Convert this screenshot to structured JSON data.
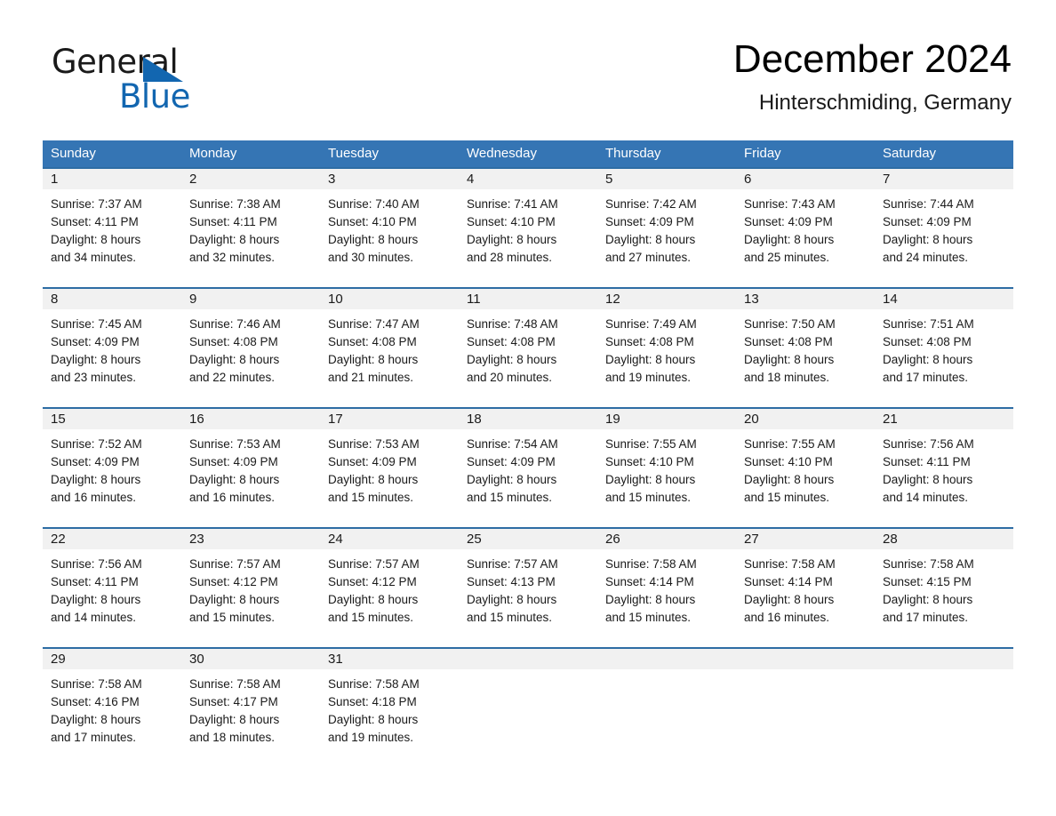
{
  "brand": {
    "name_part1": "General",
    "name_part2": "Blue",
    "triangle_color": "#1266b0",
    "logo_icon": "general-blue-logo"
  },
  "header": {
    "title": "December 2024",
    "location": "Hinterschmiding, Germany"
  },
  "colors": {
    "header_blue": "#3575b4",
    "row_divider_blue": "#2e6da4",
    "day_band_gray": "#f1f1f1",
    "text": "#1a1a1a"
  },
  "weekdays": [
    "Sunday",
    "Monday",
    "Tuesday",
    "Wednesday",
    "Thursday",
    "Friday",
    "Saturday"
  ],
  "weeks": [
    [
      {
        "day": "1",
        "sunrise": "Sunrise: 7:37 AM",
        "sunset": "Sunset: 4:11 PM",
        "daylight1": "Daylight: 8 hours",
        "daylight2": "and 34 minutes."
      },
      {
        "day": "2",
        "sunrise": "Sunrise: 7:38 AM",
        "sunset": "Sunset: 4:11 PM",
        "daylight1": "Daylight: 8 hours",
        "daylight2": "and 32 minutes."
      },
      {
        "day": "3",
        "sunrise": "Sunrise: 7:40 AM",
        "sunset": "Sunset: 4:10 PM",
        "daylight1": "Daylight: 8 hours",
        "daylight2": "and 30 minutes."
      },
      {
        "day": "4",
        "sunrise": "Sunrise: 7:41 AM",
        "sunset": "Sunset: 4:10 PM",
        "daylight1": "Daylight: 8 hours",
        "daylight2": "and 28 minutes."
      },
      {
        "day": "5",
        "sunrise": "Sunrise: 7:42 AM",
        "sunset": "Sunset: 4:09 PM",
        "daylight1": "Daylight: 8 hours",
        "daylight2": "and 27 minutes."
      },
      {
        "day": "6",
        "sunrise": "Sunrise: 7:43 AM",
        "sunset": "Sunset: 4:09 PM",
        "daylight1": "Daylight: 8 hours",
        "daylight2": "and 25 minutes."
      },
      {
        "day": "7",
        "sunrise": "Sunrise: 7:44 AM",
        "sunset": "Sunset: 4:09 PM",
        "daylight1": "Daylight: 8 hours",
        "daylight2": "and 24 minutes."
      }
    ],
    [
      {
        "day": "8",
        "sunrise": "Sunrise: 7:45 AM",
        "sunset": "Sunset: 4:09 PM",
        "daylight1": "Daylight: 8 hours",
        "daylight2": "and 23 minutes."
      },
      {
        "day": "9",
        "sunrise": "Sunrise: 7:46 AM",
        "sunset": "Sunset: 4:08 PM",
        "daylight1": "Daylight: 8 hours",
        "daylight2": "and 22 minutes."
      },
      {
        "day": "10",
        "sunrise": "Sunrise: 7:47 AM",
        "sunset": "Sunset: 4:08 PM",
        "daylight1": "Daylight: 8 hours",
        "daylight2": "and 21 minutes."
      },
      {
        "day": "11",
        "sunrise": "Sunrise: 7:48 AM",
        "sunset": "Sunset: 4:08 PM",
        "daylight1": "Daylight: 8 hours",
        "daylight2": "and 20 minutes."
      },
      {
        "day": "12",
        "sunrise": "Sunrise: 7:49 AM",
        "sunset": "Sunset: 4:08 PM",
        "daylight1": "Daylight: 8 hours",
        "daylight2": "and 19 minutes."
      },
      {
        "day": "13",
        "sunrise": "Sunrise: 7:50 AM",
        "sunset": "Sunset: 4:08 PM",
        "daylight1": "Daylight: 8 hours",
        "daylight2": "and 18 minutes."
      },
      {
        "day": "14",
        "sunrise": "Sunrise: 7:51 AM",
        "sunset": "Sunset: 4:08 PM",
        "daylight1": "Daylight: 8 hours",
        "daylight2": "and 17 minutes."
      }
    ],
    [
      {
        "day": "15",
        "sunrise": "Sunrise: 7:52 AM",
        "sunset": "Sunset: 4:09 PM",
        "daylight1": "Daylight: 8 hours",
        "daylight2": "and 16 minutes."
      },
      {
        "day": "16",
        "sunrise": "Sunrise: 7:53 AM",
        "sunset": "Sunset: 4:09 PM",
        "daylight1": "Daylight: 8 hours",
        "daylight2": "and 16 minutes."
      },
      {
        "day": "17",
        "sunrise": "Sunrise: 7:53 AM",
        "sunset": "Sunset: 4:09 PM",
        "daylight1": "Daylight: 8 hours",
        "daylight2": "and 15 minutes."
      },
      {
        "day": "18",
        "sunrise": "Sunrise: 7:54 AM",
        "sunset": "Sunset: 4:09 PM",
        "daylight1": "Daylight: 8 hours",
        "daylight2": "and 15 minutes."
      },
      {
        "day": "19",
        "sunrise": "Sunrise: 7:55 AM",
        "sunset": "Sunset: 4:10 PM",
        "daylight1": "Daylight: 8 hours",
        "daylight2": "and 15 minutes."
      },
      {
        "day": "20",
        "sunrise": "Sunrise: 7:55 AM",
        "sunset": "Sunset: 4:10 PM",
        "daylight1": "Daylight: 8 hours",
        "daylight2": "and 15 minutes."
      },
      {
        "day": "21",
        "sunrise": "Sunrise: 7:56 AM",
        "sunset": "Sunset: 4:11 PM",
        "daylight1": "Daylight: 8 hours",
        "daylight2": "and 14 minutes."
      }
    ],
    [
      {
        "day": "22",
        "sunrise": "Sunrise: 7:56 AM",
        "sunset": "Sunset: 4:11 PM",
        "daylight1": "Daylight: 8 hours",
        "daylight2": "and 14 minutes."
      },
      {
        "day": "23",
        "sunrise": "Sunrise: 7:57 AM",
        "sunset": "Sunset: 4:12 PM",
        "daylight1": "Daylight: 8 hours",
        "daylight2": "and 15 minutes."
      },
      {
        "day": "24",
        "sunrise": "Sunrise: 7:57 AM",
        "sunset": "Sunset: 4:12 PM",
        "daylight1": "Daylight: 8 hours",
        "daylight2": "and 15 minutes."
      },
      {
        "day": "25",
        "sunrise": "Sunrise: 7:57 AM",
        "sunset": "Sunset: 4:13 PM",
        "daylight1": "Daylight: 8 hours",
        "daylight2": "and 15 minutes."
      },
      {
        "day": "26",
        "sunrise": "Sunrise: 7:58 AM",
        "sunset": "Sunset: 4:14 PM",
        "daylight1": "Daylight: 8 hours",
        "daylight2": "and 15 minutes."
      },
      {
        "day": "27",
        "sunrise": "Sunrise: 7:58 AM",
        "sunset": "Sunset: 4:14 PM",
        "daylight1": "Daylight: 8 hours",
        "daylight2": "and 16 minutes."
      },
      {
        "day": "28",
        "sunrise": "Sunrise: 7:58 AM",
        "sunset": "Sunset: 4:15 PM",
        "daylight1": "Daylight: 8 hours",
        "daylight2": "and 17 minutes."
      }
    ],
    [
      {
        "day": "29",
        "sunrise": "Sunrise: 7:58 AM",
        "sunset": "Sunset: 4:16 PM",
        "daylight1": "Daylight: 8 hours",
        "daylight2": "and 17 minutes."
      },
      {
        "day": "30",
        "sunrise": "Sunrise: 7:58 AM",
        "sunset": "Sunset: 4:17 PM",
        "daylight1": "Daylight: 8 hours",
        "daylight2": "and 18 minutes."
      },
      {
        "day": "31",
        "sunrise": "Sunrise: 7:58 AM",
        "sunset": "Sunset: 4:18 PM",
        "daylight1": "Daylight: 8 hours",
        "daylight2": "and 19 minutes."
      },
      {
        "day": "",
        "sunrise": "",
        "sunset": "",
        "daylight1": "",
        "daylight2": ""
      },
      {
        "day": "",
        "sunrise": "",
        "sunset": "",
        "daylight1": "",
        "daylight2": ""
      },
      {
        "day": "",
        "sunrise": "",
        "sunset": "",
        "daylight1": "",
        "daylight2": ""
      },
      {
        "day": "",
        "sunrise": "",
        "sunset": "",
        "daylight1": "",
        "daylight2": ""
      }
    ]
  ]
}
